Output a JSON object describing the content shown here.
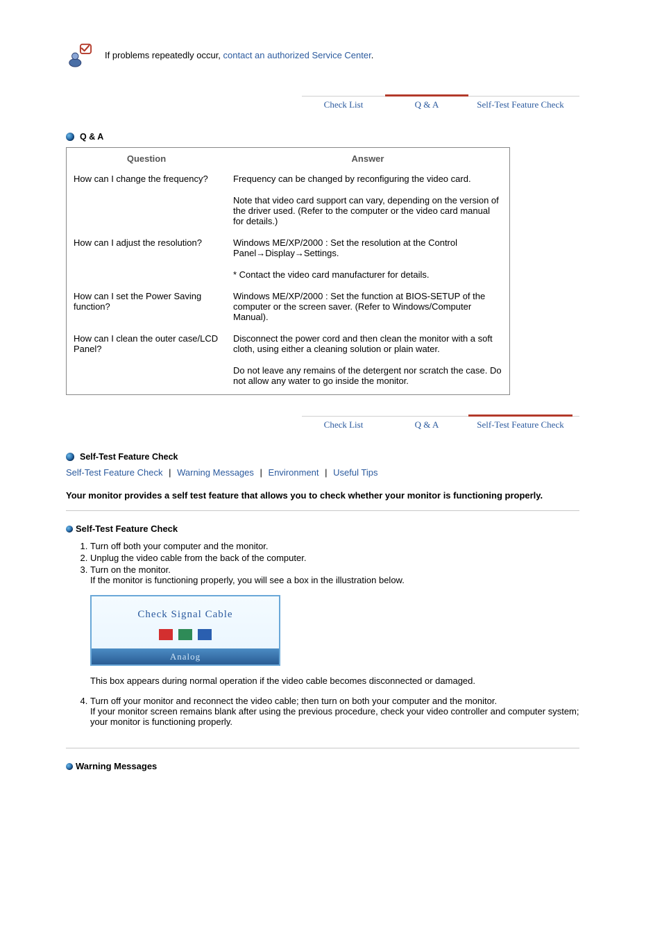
{
  "intro": {
    "prefix": "If problems repeatedly occur, ",
    "link": "contact an authorized Service Center",
    "suffix": "."
  },
  "tabs": {
    "check_list": "Check List",
    "qa": "Q & A",
    "self_test": "Self-Test Feature Check"
  },
  "qa_section": {
    "heading": "Q & A",
    "head_q": "Question",
    "head_a": "Answer",
    "rows": [
      {
        "q": "How can I change the frequency?",
        "a1": "Frequency can be changed by reconfiguring the video card.",
        "a2": "Note that video card support can vary, depending on the version of the driver used. (Refer to the computer or the video card manual for details.)"
      },
      {
        "q": "How can I adjust the resolution?",
        "a1": "Windows ME/XP/2000 : Set the resolution at the Control Panel→Display→Settings.",
        "a2": "* Contact the video card manufacturer for details."
      },
      {
        "q": "How can I set the Power Saving function?",
        "a1": "Windows ME/XP/2000 : Set the function at BIOS-SETUP of the computer or the screen saver. (Refer to Windows/Computer Manual).",
        "a2": ""
      },
      {
        "q": "How can I clean the outer case/LCD Panel?",
        "a1": "Disconnect the power cord and then clean the monitor with a soft cloth, using either a cleaning solution or plain water.",
        "a2": "Do not leave any remains of the detergent nor scratch the case. Do not allow any water to go inside the monitor."
      }
    ]
  },
  "self_test_section": {
    "heading": "Self-Test Feature Check",
    "links": {
      "a": "Self-Test Feature Check",
      "b": "Warning Messages",
      "c": "Environment",
      "d": "Useful Tips"
    },
    "intro": "Your monitor provides a self test feature that allows you to check whether your monitor is functioning properly.",
    "subhead": "Self-Test Feature Check",
    "steps": {
      "s1": "Turn off both your computer and the monitor.",
      "s2": "Unplug the video cable from the back of the computer.",
      "s3": "Turn on the monitor.",
      "s3b": "If the monitor is functioning properly, you will see a box in the illustration below.",
      "box_title": "Check Signal Cable",
      "box_footer": "Analog",
      "after_box": "This box appears during normal operation if the video cable becomes disconnected or damaged.",
      "s4": "Turn off your monitor and reconnect the video cable; then turn on both your computer and the monitor.",
      "s4b": "If your monitor screen remains blank after using the previous procedure, check your video controller and computer system; your monitor is functioning properly."
    },
    "warning_heading": "Warning Messages"
  }
}
